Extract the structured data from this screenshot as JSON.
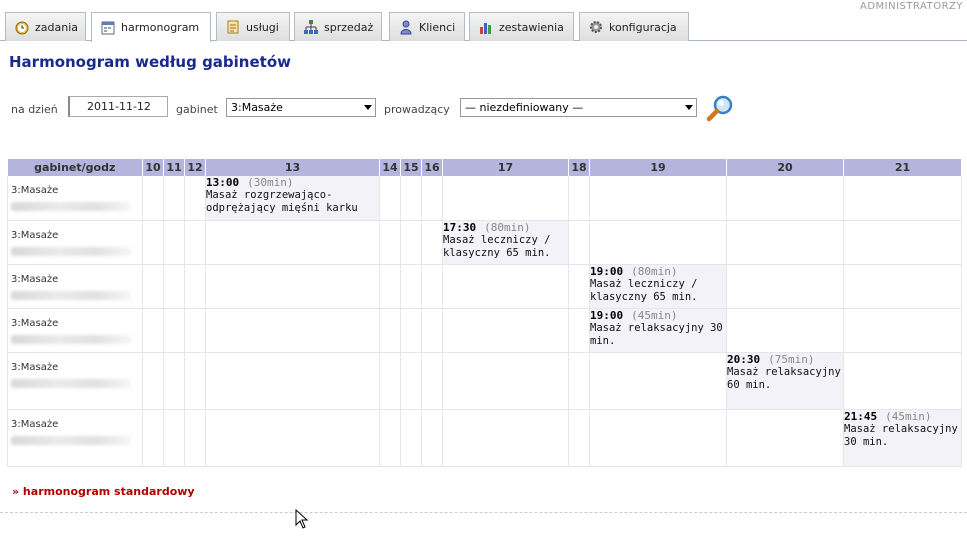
{
  "header": {
    "admin_label": "ADMINISTRATORZY"
  },
  "tabs": [
    {
      "label": "zadania",
      "icon": "clock-icon"
    },
    {
      "label": "harmonogram",
      "icon": "calendar-icon"
    },
    {
      "label": "usługi",
      "icon": "notepad-icon"
    },
    {
      "label": "sprzedaż",
      "icon": "sitemap-icon"
    },
    {
      "label": "Klienci",
      "icon": "user-icon"
    },
    {
      "label": "zestawienia",
      "icon": "bar-chart-icon"
    },
    {
      "label": "konfiguracja",
      "icon": "gear-icon"
    }
  ],
  "active_tab": "harmonogram",
  "page_title": "Harmonogram według gabinetów",
  "filters": {
    "date_label": "na dzień",
    "date_value": "2011-11-12",
    "room_label": "gabinet",
    "room_value": "3:Masaże",
    "staff_label": "prowadzący",
    "staff_value": "— niezdefiniowany —"
  },
  "grid": {
    "corner_header": "gabinet/godz",
    "hours": [
      "10",
      "11",
      "12",
      "13",
      "14",
      "15",
      "16",
      "17",
      "18",
      "19",
      "20",
      "21"
    ],
    "rows": [
      {
        "room": "3:Masaże",
        "time": "13:00",
        "duration": "(30min)",
        "desc": "Masaż rozgrzewająco-odprężający mięśni karku"
      },
      {
        "room": "3:Masaże",
        "time": "17:30",
        "duration": "(80min)",
        "desc": "Masaż leczniczy / klasyczny 65 min."
      },
      {
        "room": "3:Masaże",
        "time": "19:00",
        "duration": "(80min)",
        "desc": "Masaż leczniczy / klasyczny 65 min."
      },
      {
        "room": "3:Masaże",
        "time": "19:00",
        "duration": "(45min)",
        "desc": "Masaż relaksacyjny 30 min."
      },
      {
        "room": "3:Masaże",
        "time": "20:30",
        "duration": "(75min)",
        "desc": "Masaż relaksacyjny 60 min."
      },
      {
        "room": "3:Masaże",
        "time": "21:45",
        "duration": "(45min)",
        "desc": "Masaż relaksacyjny 30 min."
      }
    ]
  },
  "footer_link": "» harmonogram standardowy"
}
